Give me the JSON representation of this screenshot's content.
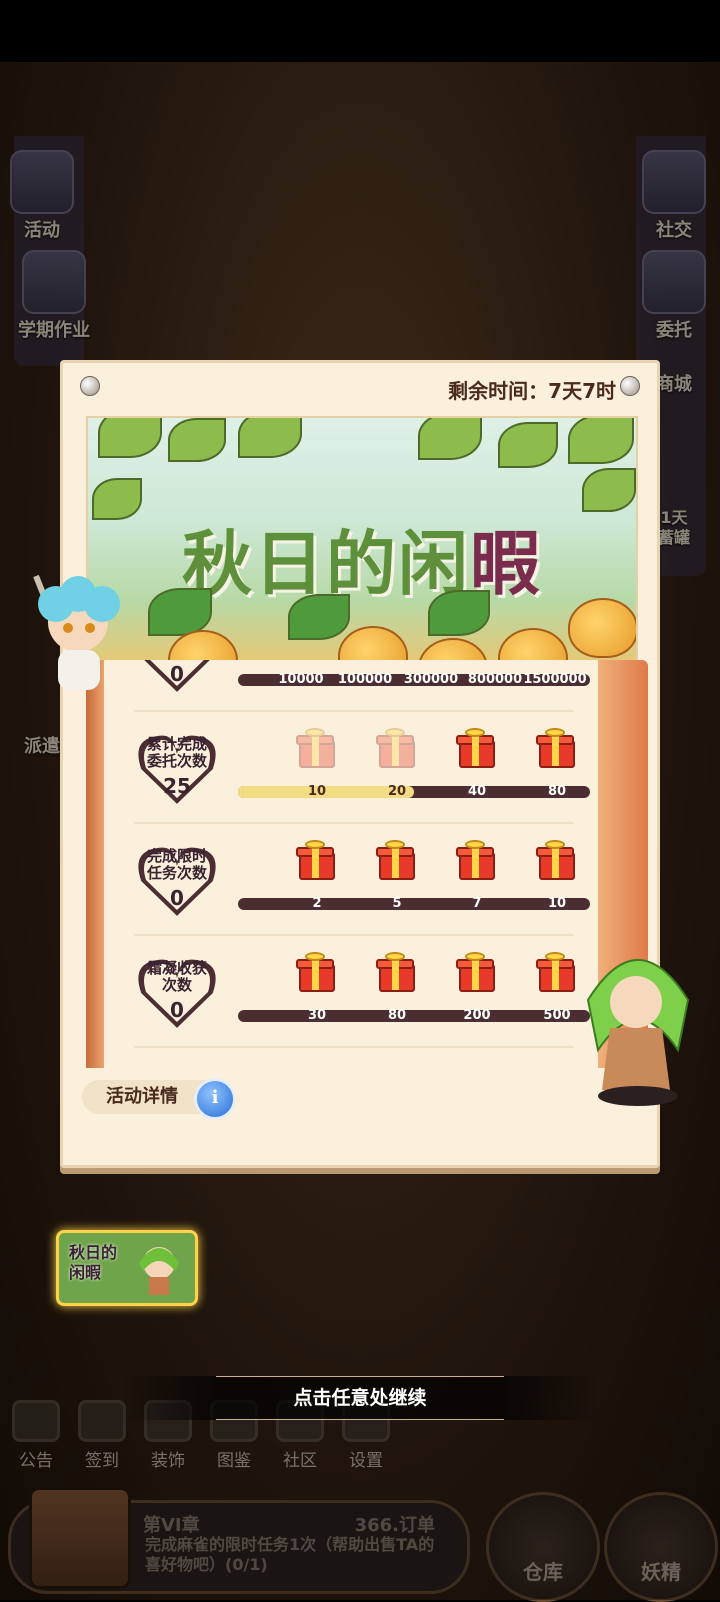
{
  "timer": "剩余时间：7天7时",
  "event_title_main": "秋日的闲",
  "event_title_accent": "暇",
  "side_left": [
    "活动",
    "学期作业"
  ],
  "side_left_small": "派遣",
  "side_right": [
    "社交",
    "委托",
    "商城"
  ],
  "side_right_small": "1天\n蓄罐",
  "tasks": [
    {
      "label": "",
      "value": "0",
      "milestones": [
        "10000",
        "100000",
        "300000",
        "800000",
        "1500000"
      ],
      "progress": 0
    },
    {
      "label": "累计完成\n委托次数",
      "value": "25",
      "milestones": [
        "10",
        "20",
        "40",
        "80"
      ],
      "claimed": [
        true,
        true,
        false,
        false
      ],
      "progress": 0.5
    },
    {
      "label": "完成限时\n任务次数",
      "value": "0",
      "milestones": [
        "2",
        "5",
        "7",
        "10"
      ],
      "claimed": [
        false,
        false,
        false,
        false
      ],
      "progress": 0
    },
    {
      "label": "霜凝收获\n次数",
      "value": "0",
      "milestones": [
        "30",
        "80",
        "200",
        "500"
      ],
      "claimed": [
        false,
        false,
        false,
        false
      ],
      "progress": 0
    }
  ],
  "details_label": "活动详情",
  "info_icon": "i",
  "minicard_label": "秋日的\n闲暇",
  "continue_text": "点击任意处继续",
  "bottom_nav": [
    "公告",
    "签到",
    "装饰",
    "图鉴",
    "社区",
    "设置"
  ],
  "quest": {
    "chapter": "第VI章",
    "count": "366.订单",
    "description": "完成麻雀的限时任务1次（帮助出售TA的喜好物吧）(0/1)"
  },
  "big_buttons": [
    "仓库",
    "妖精"
  ],
  "colors": {
    "paper": "#fbf0dc",
    "bar": "#4a2e34",
    "bar_fill": "#f3dd84",
    "gift": "#e83a2a",
    "accent": "#7a2c4c"
  }
}
